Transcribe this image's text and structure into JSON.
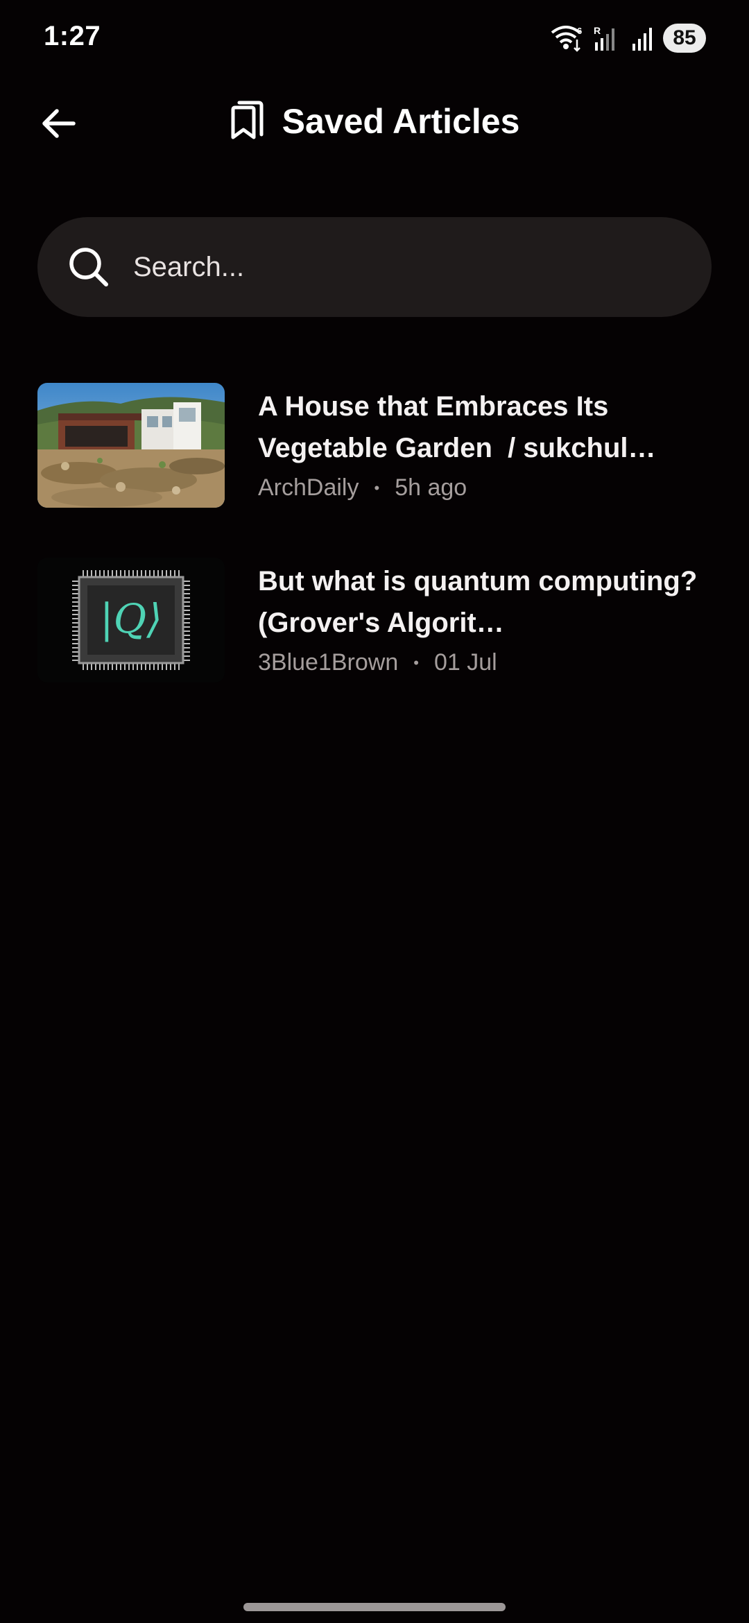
{
  "status_bar": {
    "time": "1:27",
    "network_label": "R",
    "wifi_badge": "6",
    "battery": "85"
  },
  "app_bar": {
    "title": "Saved Articles",
    "back_icon": "arrow-left-icon",
    "title_icon": "bookmarks-icon"
  },
  "search": {
    "placeholder": "Search...",
    "value": "",
    "icon": "search-icon"
  },
  "articles": [
    {
      "title": "A House that Embraces Its Vegetable Garden  / sukchul…",
      "source": "ArchDaily",
      "time": "5h ago",
      "thumbnail": "house-photo"
    },
    {
      "title": "But what is quantum computing?  (Grover's Algorit…",
      "source": "3Blue1Brown",
      "time": "01 Jul",
      "thumbnail": "quantum-chip-image"
    }
  ],
  "colors": {
    "background": "#050203",
    "search_bg": "#1f1b1b",
    "meta_text": "#a59e9d",
    "quantum_accent": "#4fd3b5"
  }
}
